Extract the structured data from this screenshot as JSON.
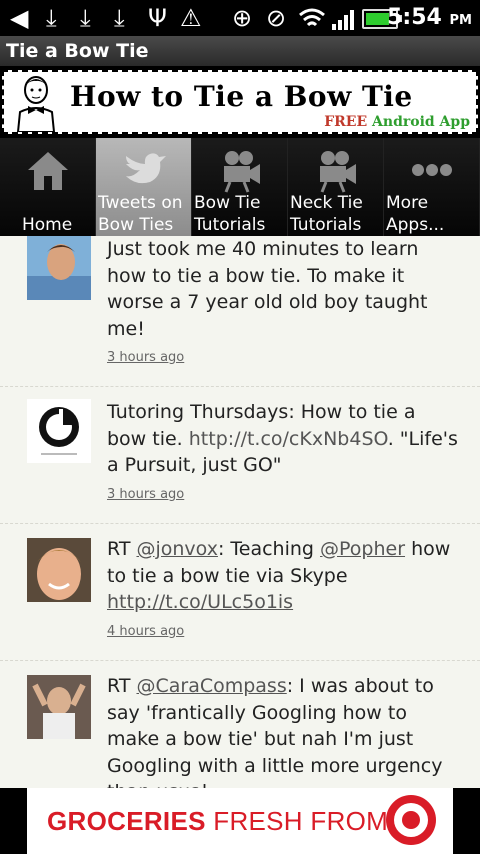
{
  "status_bar": {
    "time": "5:54",
    "ampm": "PM",
    "icons": [
      "back-arrow-icon",
      "download-icon",
      "download-icon",
      "download-icon",
      "usb-icon",
      "warning-icon",
      "gps-icon",
      "no-sound-icon",
      "wifi-icon",
      "signal-icon",
      "battery-icon"
    ],
    "battery_level": 0.9,
    "battery_color": "#2ecc2e"
  },
  "title_bar": {
    "title": "Tie a Bow Tie"
  },
  "banner": {
    "title": "How to Tie a Bow Tie",
    "free": "FREE",
    "app": "Android App"
  },
  "tabs": [
    {
      "label": "Home",
      "icon": "home-icon"
    },
    {
      "label": "Tweets on\nBow Ties",
      "icon": "bird-icon",
      "active": true
    },
    {
      "label": "Bow Tie\nTutorials",
      "icon": "movie-camera-icon"
    },
    {
      "label": "Neck Tie\nTutorials",
      "icon": "movie-camera-icon"
    },
    {
      "label": "More\nApps...",
      "icon": "more-dots-icon"
    }
  ],
  "tweets": [
    {
      "text": "Just took me 40 minutes to learn how to tie a bow tie. To make it worse a 7 year old old boy taught me!",
      "time": "3 hours ago"
    },
    {
      "text_before": "Tutoring Thursdays: How to tie a bow tie. ",
      "link": "http://t.co/cKxNb4SO",
      "text_after": ". \"Life's a Pursuit, just GO\"",
      "time": "3 hours ago"
    },
    {
      "rt": "RT ",
      "mention1": "@jonvox",
      "mid": ": Teaching ",
      "mention2": "@Popher",
      "text": " how to tie a bow tie via Skype ",
      "link": "http://t.co/ULc5o1is",
      "time": "4 hours ago"
    },
    {
      "rt": "RT ",
      "mention": "@CaraCompass",
      "text": ": I was about to say 'frantically Googling how to make a bow tie' but nah I'm just Googling with a little more urgency than usual"
    }
  ],
  "ad": {
    "bold": "GROCERIES",
    "rest": " FRESH FROM",
    "brand_color": "#d91c27"
  }
}
